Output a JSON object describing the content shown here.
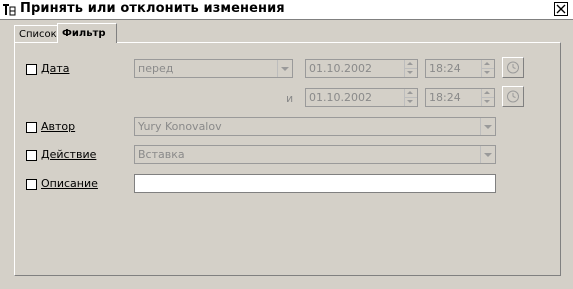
{
  "window": {
    "title": "Принять или отклонить изменения"
  },
  "tabs": [
    {
      "label": "Список",
      "active": false
    },
    {
      "label": "Фильтр",
      "active": true
    }
  ],
  "filter": {
    "date": {
      "checkbox_label": "Дата",
      "checked": false,
      "condition": "перед",
      "date_from": "01.10.2002",
      "time_from": "18:24",
      "and_label": "и",
      "date_to": "01.10.2002",
      "time_to": "18:24"
    },
    "author": {
      "checkbox_label": "Автор",
      "checked": false,
      "value": "Yury Konovalov"
    },
    "action": {
      "checkbox_label": "Действие",
      "checked": false,
      "value": "Вставка"
    },
    "comment": {
      "checkbox_label": "Описание",
      "checked": false,
      "value": ""
    }
  },
  "icons": {
    "app": "app-icon",
    "close": "close-icon",
    "clock": "clock-icon"
  }
}
